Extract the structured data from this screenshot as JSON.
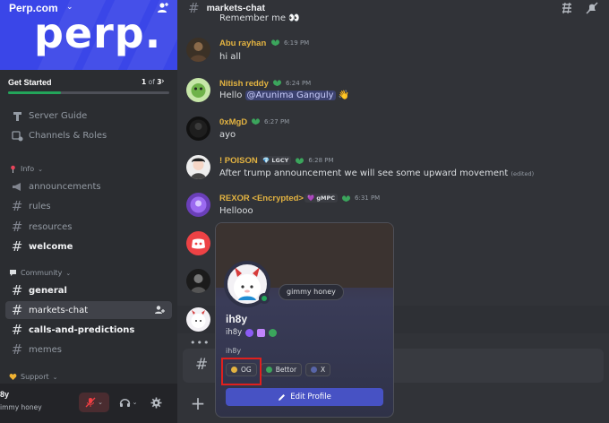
{
  "server": {
    "name": "Perp.com",
    "banner_logo": "perp.",
    "getting_started": {
      "label": "Get Started",
      "done": "1",
      "of": "of",
      "total": "3",
      "progress": 0.33
    }
  },
  "sidebar": {
    "utility": [
      {
        "label": "Server Guide",
        "icon": "server-guide-icon"
      },
      {
        "label": "Channels & Roles",
        "icon": "channels-roles-icon"
      }
    ],
    "categories": [
      {
        "label": "Info",
        "icon": "pin-icon"
      },
      {
        "label": "Community",
        "icon": "speech-bubble-icon"
      },
      {
        "label": "Support",
        "icon": "heart-icon"
      }
    ],
    "info_channels": [
      {
        "label": "announcements",
        "icon": "megaphone-icon"
      },
      {
        "label": "rules",
        "icon": "hash-icon"
      },
      {
        "label": "resources",
        "icon": "hash-icon"
      },
      {
        "label": "welcome",
        "icon": "hash-icon"
      }
    ],
    "community_channels": [
      {
        "label": "general"
      },
      {
        "label": "markets-chat"
      },
      {
        "label": "calls-and-predictions"
      },
      {
        "label": "memes"
      }
    ]
  },
  "user_panel": {
    "name": "8y",
    "status": "immy honey"
  },
  "channel": {
    "title": "markets-chat"
  },
  "messages": [
    {
      "author": "",
      "time": "",
      "text": "Remember me 👀"
    },
    {
      "author": "Abu rayhan",
      "time": "6:19 PM",
      "text": "hi all",
      "color": "#e3b341"
    },
    {
      "author": "Nitish reddy",
      "time": "6:24 PM",
      "text_prefix": "Hello ",
      "mention": "@Arunima Ganguly",
      "emoji": "👋",
      "color": "#e3b341"
    },
    {
      "author": "0xMgD",
      "time": "6:27 PM",
      "text": "ayo",
      "color": "#e3b341"
    },
    {
      "author": "! POISON",
      "role": "LGCY",
      "time": "6:28 PM",
      "text": "After trump announcement we will see some upward movement",
      "edited": "(edited)",
      "color": "#e3b341"
    },
    {
      "author": "REXOR <Encrypted>",
      "role": "gMPC",
      "time": "6:31 PM",
      "text": "Hellooo",
      "color": "#e3b341"
    }
  ],
  "profile": {
    "display_name": "ih8y",
    "username": "ih8y",
    "pronouns": "ih8y",
    "custom_status": "gimmy honey",
    "roles": [
      {
        "label": "OG",
        "color": "#e3b341"
      },
      {
        "label": "Bettor",
        "color": "#3ba55c"
      },
      {
        "label": "X",
        "color": "#5865a8"
      }
    ],
    "edit_button": "Edit Profile"
  }
}
